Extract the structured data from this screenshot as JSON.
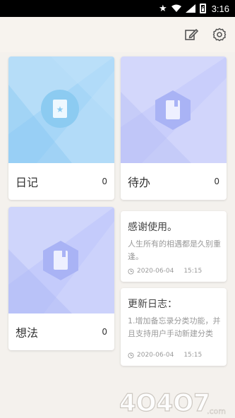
{
  "status_bar": {
    "time": "3:16"
  },
  "toolbar": {
    "edit_icon": "edit-icon",
    "settings_icon": "gear-icon"
  },
  "categories": [
    {
      "name": "日记",
      "count": "0",
      "icon": "book-star-icon",
      "color": "#a9d8f7"
    },
    {
      "name": "待办",
      "count": "0",
      "icon": "book-icon",
      "color": "#c8cdfb"
    },
    {
      "name": "想法",
      "count": "0",
      "icon": "book-icon",
      "color": "#c3cbfb"
    }
  ],
  "notes": [
    {
      "title": "感谢使用。",
      "body": "人生所有的相遇都是久别重逢。",
      "date": "2020-06-04",
      "time": "15:15"
    },
    {
      "title": "更新日志：",
      "body": "1.增加备忘录分类功能，并且支持用户手动新建分类",
      "date": "2020-06-04",
      "time": "15:15"
    }
  ],
  "watermark": {
    "text": "4O4O7",
    "suffix": ".com"
  }
}
